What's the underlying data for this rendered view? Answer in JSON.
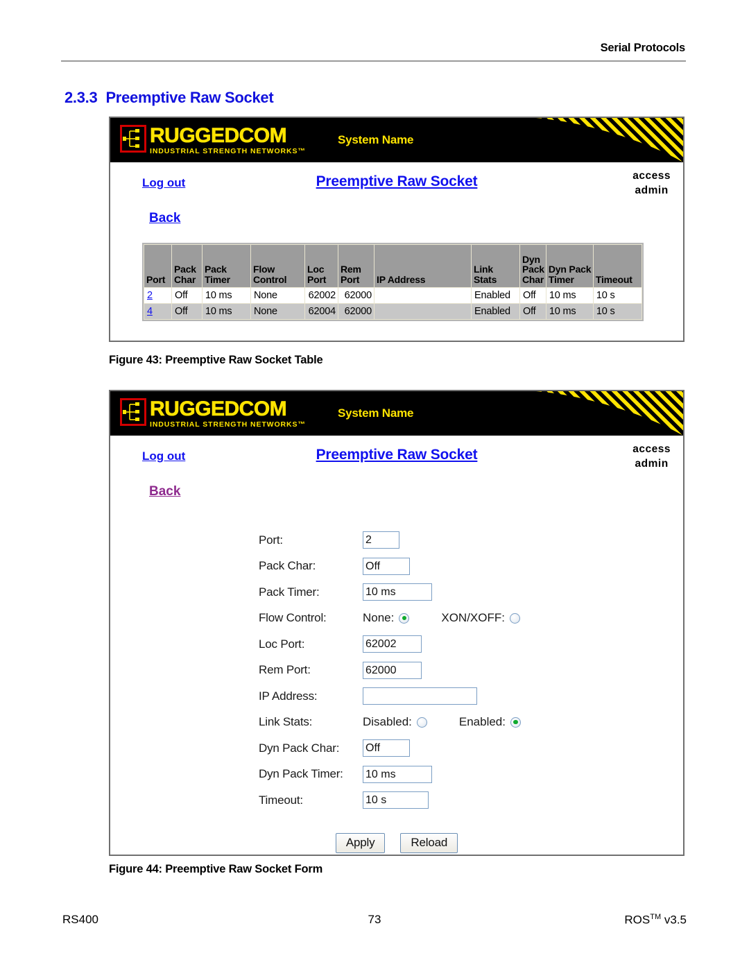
{
  "document": {
    "running_head": "Serial Protocols",
    "section_number": "2.3.3",
    "section_title": "Preemptive Raw Socket",
    "caption_43": "Figure 43: Preemptive Raw Socket Table",
    "caption_44": "Figure 44: Preemptive Raw Socket Form",
    "footer_left": "RS400",
    "footer_center": "73",
    "footer_right_product": "ROS",
    "footer_right_tm": "TM",
    "footer_right_version": "v3.5"
  },
  "appbar": {
    "logo_main": "RUGGEDCOM",
    "logo_sub": "INDUSTRIAL STRENGTH NETWORKS™",
    "system_name": "System Name",
    "logo_border_color": "#d10000",
    "logo_text_color": "#ffe400",
    "bar_bg": "#000000",
    "hazard_yellow": "#ffe400"
  },
  "nav": {
    "logout_label": "Log out",
    "page_title": "Preemptive Raw Socket",
    "access_label": "access",
    "access_user": "admin",
    "back_label": "Back",
    "link_color": "#1111ee",
    "visited_link_color": "#8e2a8e"
  },
  "table_view": {
    "columns": [
      "Port",
      "Pack Char",
      "Pack Timer",
      "Flow Control",
      "Loc Port",
      "Rem Port",
      "IP Address",
      "Link Stats",
      "Dyn Pack Char",
      "Dyn Pack Timer",
      "Timeout"
    ],
    "rows": [
      {
        "port": "2",
        "pack_char": "Off",
        "pack_timer": "10 ms",
        "flow_control": "None",
        "loc_port": "62002",
        "rem_port": "62000",
        "ip_address": "",
        "link_stats": "Enabled",
        "dyn_pack_char": "Off",
        "dyn_pack_timer": "10 ms",
        "timeout": "10 s"
      },
      {
        "port": "4",
        "pack_char": "Off",
        "pack_timer": "10 ms",
        "flow_control": "None",
        "loc_port": "62004",
        "rem_port": "62000",
        "ip_address": "",
        "link_stats": "Enabled",
        "dyn_pack_char": "Off",
        "dyn_pack_timer": "10 ms",
        "timeout": "10 s"
      }
    ],
    "header_bg": "#9c9c9c",
    "row_alt_bg": "#c7c7c7"
  },
  "form_view": {
    "fields": {
      "port_label": "Port:",
      "port_value": "2",
      "pack_char_label": "Pack Char:",
      "pack_char_value": "Off",
      "pack_timer_label": "Pack Timer:",
      "pack_timer_value": "10 ms",
      "flow_control_label": "Flow Control:",
      "flow_none_label": "None:",
      "flow_xonxoff_label": "XON/XOFF:",
      "loc_port_label": "Loc Port:",
      "loc_port_value": "62002",
      "rem_port_label": "Rem Port:",
      "rem_port_value": "62000",
      "ip_address_label": "IP Address:",
      "ip_address_value": "",
      "link_stats_label": "Link Stats:",
      "link_disabled_label": "Disabled:",
      "link_enabled_label": "Enabled:",
      "dyn_pack_char_label": "Dyn Pack Char:",
      "dyn_pack_char_value": "Off",
      "dyn_pack_timer_label": "Dyn Pack Timer:",
      "dyn_pack_timer_value": "10 ms",
      "timeout_label": "Timeout:",
      "timeout_value": "10 s"
    },
    "selected": {
      "flow_control": "None",
      "link_stats": "Enabled"
    },
    "buttons": {
      "apply_label": "Apply",
      "reload_label": "Reload"
    },
    "radio_selected_color": "#0faa2e",
    "input_border_color": "#7b9ec4"
  }
}
